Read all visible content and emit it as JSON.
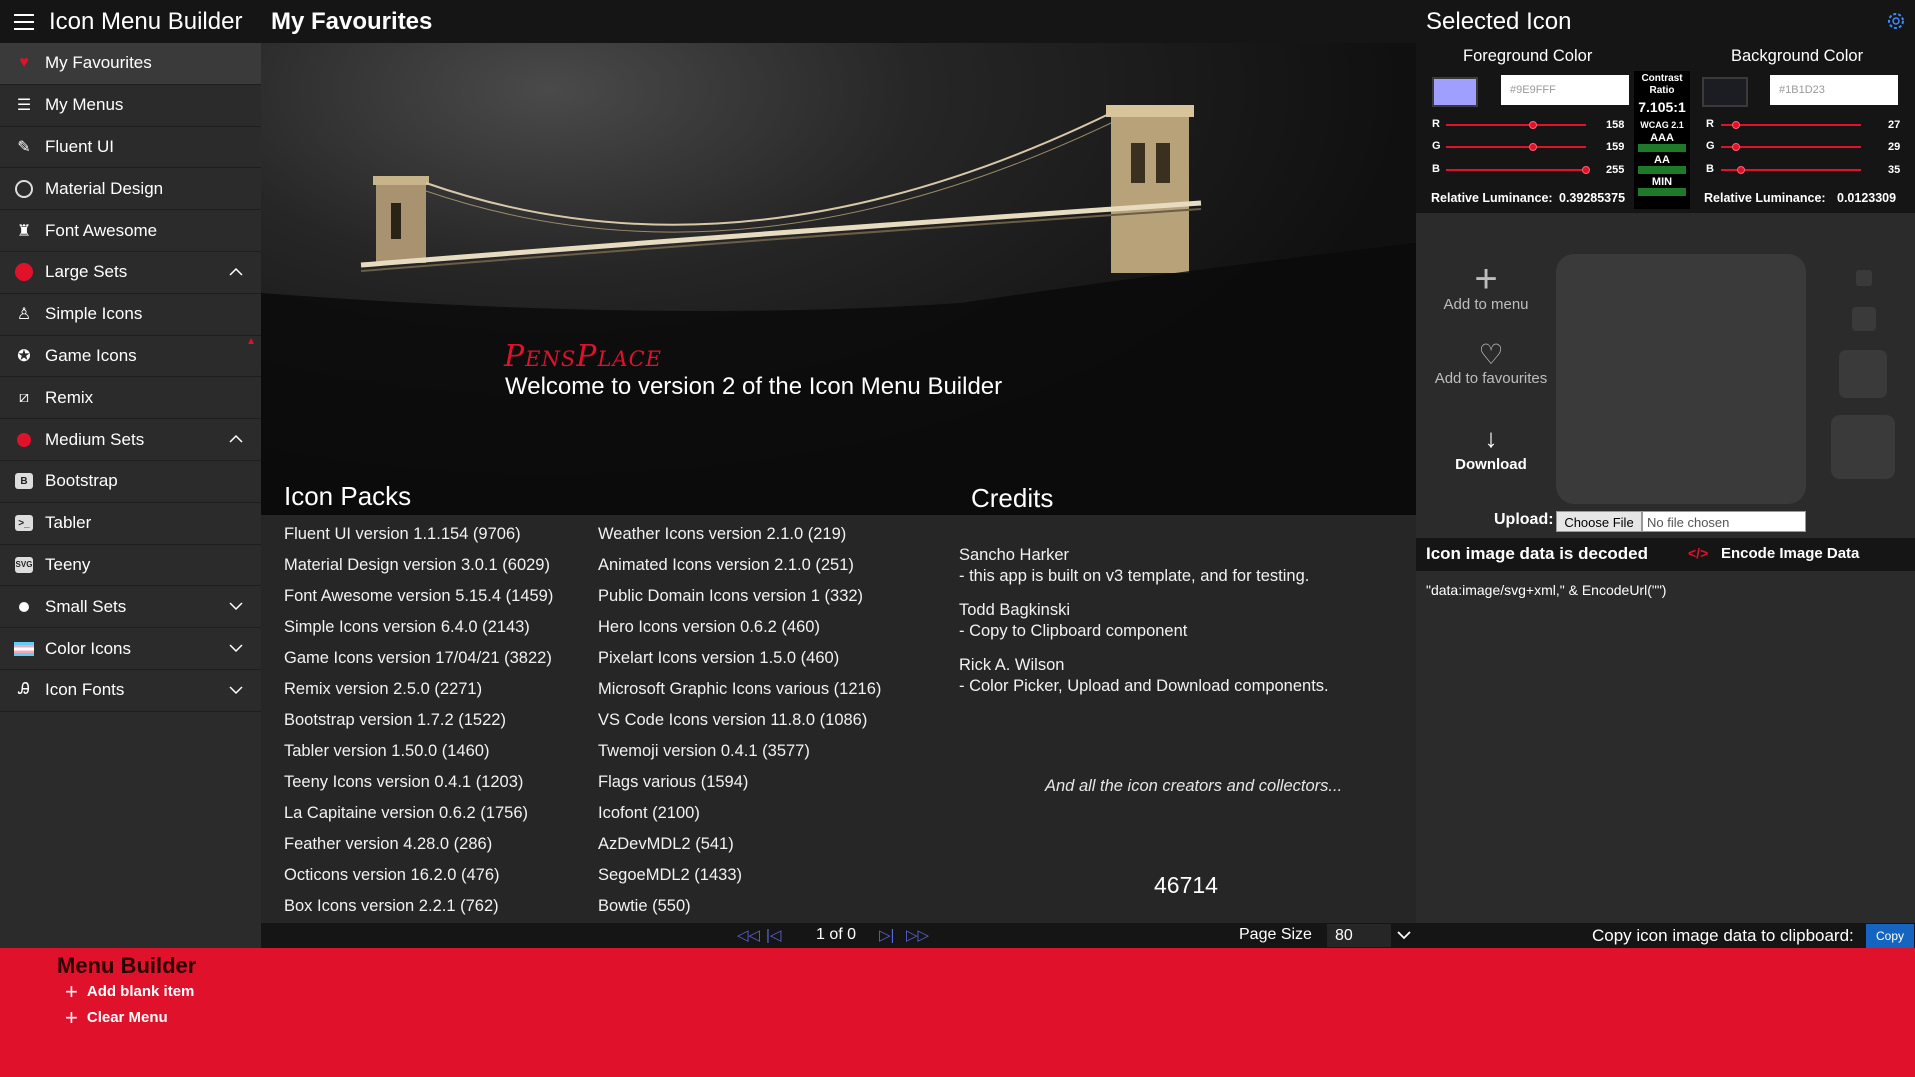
{
  "app": {
    "title": "Icon Menu Builder"
  },
  "sidebar": {
    "items": [
      {
        "label": "My Favourites",
        "icon": "heart-icon"
      },
      {
        "label": "My Menus",
        "icon": "list-icon"
      },
      {
        "label": "Fluent UI",
        "icon": "fluent-icon"
      },
      {
        "label": "Material Design",
        "icon": "material-icon"
      },
      {
        "label": "Font Awesome",
        "icon": "font-awesome-icon"
      },
      {
        "label": "Large Sets",
        "icon": "red-dot-icon"
      },
      {
        "label": "Simple Icons",
        "icon": "simple-icons-icon"
      },
      {
        "label": "Game Icons",
        "icon": "game-icon"
      },
      {
        "label": "Remix",
        "icon": "remix-icon"
      },
      {
        "label": "Medium Sets",
        "icon": "red-dot-icon"
      },
      {
        "label": "Bootstrap",
        "icon": "bootstrap-icon"
      },
      {
        "label": "Tabler",
        "icon": "tabler-icon"
      },
      {
        "label": "Teeny",
        "icon": "teeny-icon"
      },
      {
        "label": "Small Sets",
        "icon": "white-dot-icon"
      },
      {
        "label": "Color Icons",
        "icon": "flag-icon"
      },
      {
        "label": "Icon Fonts",
        "icon": "font-icon"
      }
    ]
  },
  "main": {
    "title": "My Favourites",
    "brand": "PensPlace",
    "welcome": "Welcome to version 2 of the Icon Menu Builder",
    "packs_title": "Icon Packs",
    "credits_title": "Credits",
    "packs_col1": [
      "Fluent UI version 1.1.154 (9706)",
      "Material Design version 3.0.1 (6029)",
      "Font Awesome version 5.15.4 (1459)",
      "Simple Icons version 6.4.0 (2143)",
      "Game Icons version 17/04/21 (3822)",
      "Remix version 2.5.0 (2271)",
      "Bootstrap version 1.7.2 (1522)",
      "Tabler version 1.50.0 (1460)",
      "Teeny Icons version 0.4.1 (1203)",
      "La Capitaine version 0.6.2 (1756)",
      "Feather version 4.28.0 (286)",
      "Octicons version 16.2.0 (476)",
      "Box Icons version 2.2.1 (762)"
    ],
    "packs_col2": [
      "Weather Icons version 2.1.0 (219)",
      "Animated Icons version 2.1.0 (251)",
      "Public Domain Icons version 1 (332)",
      "Hero Icons version 0.6.2 (460)",
      "Pixelart Icons version 1.5.0 (460)",
      "Microsoft Graphic Icons various (1216)",
      "VS Code Icons version 11.8.0 (1086)",
      "Twemoji version 0.4.1 (3577)",
      "Flags various (1594)",
      "Icofont (2100)",
      "AzDevMDL2 (541)",
      "SegoeMDL2 (1433)",
      "Bowtie (550)"
    ],
    "credits": [
      {
        "name": "Sancho Harker",
        "desc": "- this app is built on v3 template, and for testing."
      },
      {
        "name": "Todd Bagkinski",
        "desc": "- Copy to Clipboard component"
      },
      {
        "name": "Rick A. Wilson",
        "desc": "- Color Picker, Upload and Download components."
      }
    ],
    "credits_tail": "And all the icon creators and collectors...",
    "total_count": "46714"
  },
  "pager": {
    "info": "1 of 0",
    "page_size_label": "Page Size",
    "page_size": "80"
  },
  "selected_icon": {
    "title": "Selected Icon",
    "foreground": {
      "label": "Foreground Color",
      "hex": "#9E9FFF",
      "r": "158",
      "g": "159",
      "b": "255",
      "r_frac": 0.62,
      "g_frac": 0.62,
      "b_frac": 1.0,
      "luminance_label": "Relative Luminance:",
      "luminance": "0.39285375",
      "color": "#9e9fff"
    },
    "background": {
      "label": "Background Color",
      "hex": "#1B1D23",
      "r": "27",
      "g": "29",
      "b": "35",
      "r_frac": 0.11,
      "g_frac": 0.11,
      "b_frac": 0.14,
      "luminance_label": "Relative Luminance:",
      "luminance": "0.0123309",
      "color": "#1b1d23"
    },
    "contrast": {
      "title1": "Contrast",
      "title2": "Ratio",
      "value": "7.105:1",
      "wcag": "WCAG 2.1",
      "aaa": "AAA",
      "aa": "AA",
      "min": "MIN"
    },
    "add_to_menu": "Add to menu",
    "add_to_favourites": "Add to favourites",
    "download": "Download",
    "upload_label": "Upload:",
    "choose_file": "Choose File",
    "no_file": "No file chosen",
    "decoded_label": "Icon image data is decoded",
    "encode_label": "Encode Image Data",
    "data_text": "\"data:image/svg+xml,\" & EncodeUrl(\"\")",
    "copy_label": "Copy icon image data to clipboard:",
    "copy_button": "Copy"
  },
  "menu_builder": {
    "title": "Menu Builder",
    "add_blank": "Add blank item",
    "clear_menu": "Clear Menu"
  },
  "colors": {
    "accent": "#e0112b",
    "panel": "#2b2b2b",
    "header": "#151515",
    "link": "#5a66d6"
  }
}
